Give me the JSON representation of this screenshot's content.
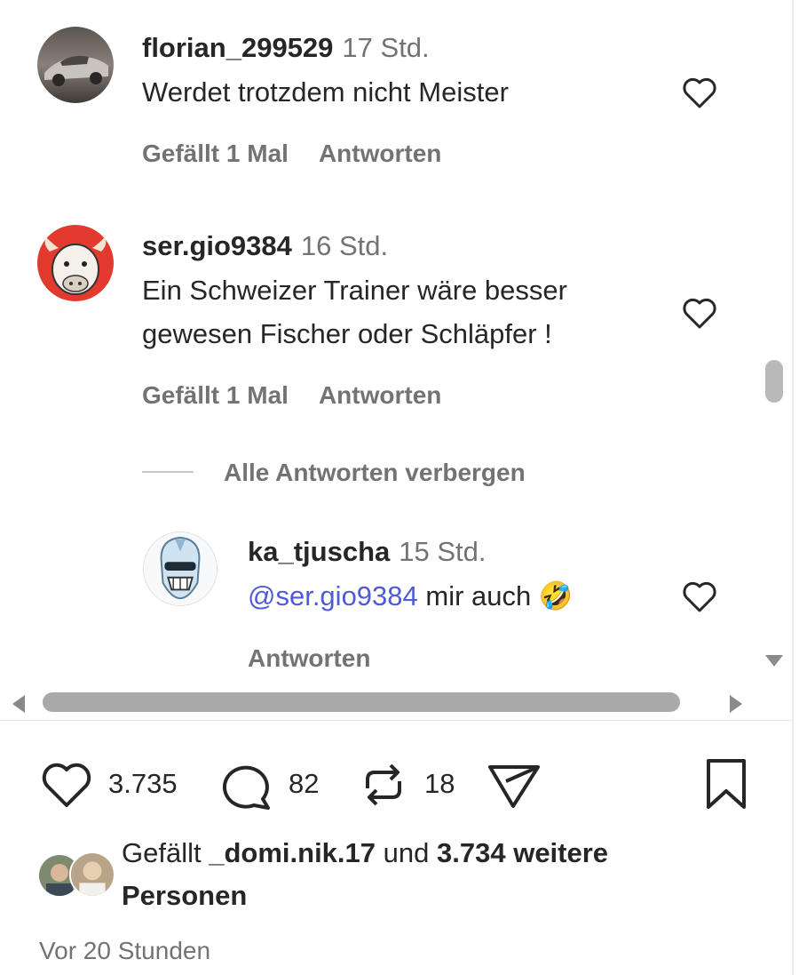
{
  "comments": [
    {
      "username": "florian_299529",
      "time": "17 Std.",
      "text": "Werdet trotzdem nicht Meister",
      "likes": "Gefällt 1 Mal",
      "reply": "Antworten"
    },
    {
      "username": "ser.gio9384",
      "time": "16 Std.",
      "text_line1": "Ein Schweizer Trainer wäre besser",
      "text_line2": "gewesen Fischer oder Schläpfer !",
      "likes": "Gefällt 1 Mal",
      "reply": "Antworten",
      "toggle_replies": "Alle Antworten verbergen",
      "replies": [
        {
          "username": "ka_tjuscha",
          "time": "15 Std.",
          "mention": "@ser.gio9384",
          "text": "mir auch",
          "emoji": "🤣",
          "reply": "Antworten"
        }
      ]
    }
  ],
  "actions": {
    "like_count": "3.735",
    "comment_count": "82",
    "repost_count": "18"
  },
  "liked_by": {
    "prefix": "Gefällt",
    "user": "_domi.nik.17",
    "connector": "und",
    "others": "3.734 weitere",
    "others_line2": "Personen"
  },
  "post_time": "Vor 20 Stunden",
  "colors": {
    "text": "#262626",
    "secondary": "#737373",
    "mention": "#4f5bd5",
    "scrollbar": "#b9b9b9"
  }
}
